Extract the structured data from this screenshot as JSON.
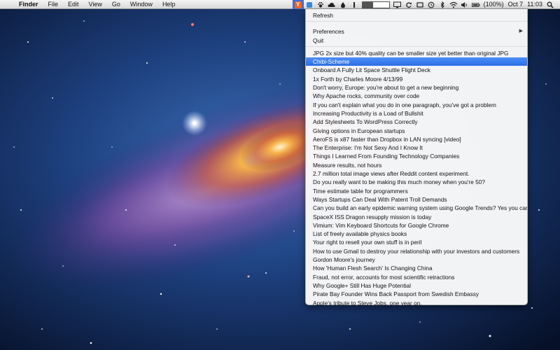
{
  "menubar": {
    "apple_glyph": "",
    "items": [
      "Finder",
      "File",
      "Edit",
      "View",
      "Go",
      "Window",
      "Help"
    ],
    "status": {
      "yc_label": "Y",
      "battery": "(100%)",
      "date": "Oct 7",
      "time": "11:03"
    }
  },
  "dropdown": {
    "refresh": "Refresh",
    "preferences": "Preferences",
    "preferences_arrow": "▶",
    "quit": "Quit",
    "stories": [
      "JPG 2x size but 40% quality can be smaller size yet better than original JPG",
      "Chibi-Scheme",
      "Onboard A Fully Lit Space Shuttle Flight Deck",
      "1x Forth by Charles Moore 4/13/99",
      "Don't worry, Europe: you're about to get a new beginning",
      "Why Apache rocks, community over code",
      "If you can't explain what you do in one paragraph, you've got a problem",
      "Increasing Productivity is a Load of Bullshit",
      "Add Stylesheets To WordPress Correctly",
      "Giving options in European startups",
      "AeroFS is x87 faster than Dropbox in LAN syncing [video]",
      "The Enterprise: I'm Not Sexy And I Know It",
      "Things I Learned From Founding Technology Companies",
      "Measure results, not hours",
      "2.7 million total image views after Reddit content experiment.",
      "Do you really want to be making this much money when you're 50?",
      "Time estimate table for programmers",
      "Ways Startups Can Deal With Patent Troll Demands",
      "Can you build an early epidemic warning system using Google Trends? Yes you can",
      "SpaceX ISS Dragon resupply mission is today",
      "Vimium: Vim Keyboard Shortcuts for Google Chrome",
      "List of freely available physics books",
      "Your right to resell your own stuff is in peril",
      "How to use Gmail to destroy your relationship with your investors and customers",
      "Gordon Moore's journey",
      "How 'Human Flesh Search' Is Changing China",
      "Fraud, not error, accounts for most scientific retractions",
      "Why Google+ Still Has Huge Potential",
      "Pirate Bay Founder Wins Back Passport from Swedish Embassy",
      "Apple's tribute to Steve Jobs, one year on."
    ],
    "selected_index": 1
  },
  "colors": {
    "selection": "#2c6fe6",
    "yc_orange": "#f26522"
  }
}
